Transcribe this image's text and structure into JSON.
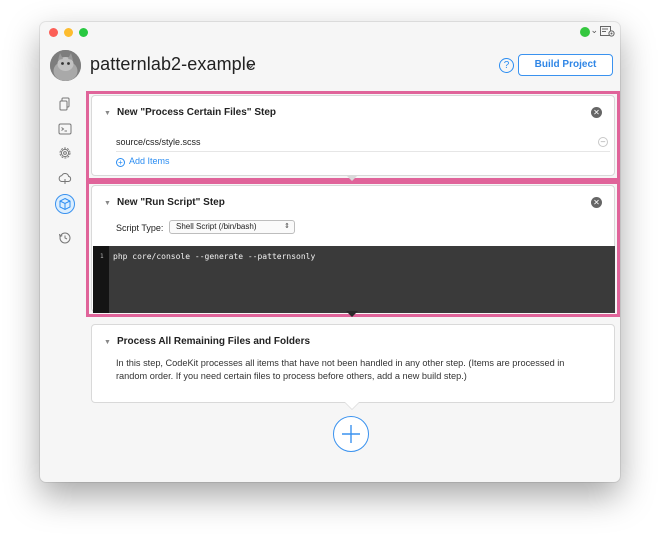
{
  "header": {
    "project_name": "patternlab2-example",
    "help_label": "?",
    "build_label": "Build Project"
  },
  "colors": {
    "accent": "#2b8df2",
    "highlight": "#e0649a",
    "status": "#35c73f",
    "code_bg": "#3a3a3a"
  },
  "sidebar": {
    "items": [
      {
        "name": "files-icon"
      },
      {
        "name": "terminal-icon"
      },
      {
        "name": "gear-icon"
      },
      {
        "name": "cloud-icon"
      },
      {
        "name": "build-steps-icon",
        "active": true
      },
      {
        "name": "history-icon"
      }
    ]
  },
  "steps": {
    "process_files": {
      "title": "New \"Process Certain Files\" Step",
      "files": [
        "source/css/style.scss"
      ],
      "add_items_label": "Add Items"
    },
    "run_script": {
      "title": "New \"Run Script\" Step",
      "script_type_label": "Script Type:",
      "script_type_value": "Shell Script (/bin/bash)",
      "line_number": "1",
      "code": "php core/console --generate --patternsonly"
    },
    "remaining": {
      "title": "Process All Remaining Files and Folders",
      "description": "In this step, CodeKit processes all items that have not been handled in any other step. (Items are processed in random order. If you need certain files to process before others, add a new build step.)"
    }
  }
}
